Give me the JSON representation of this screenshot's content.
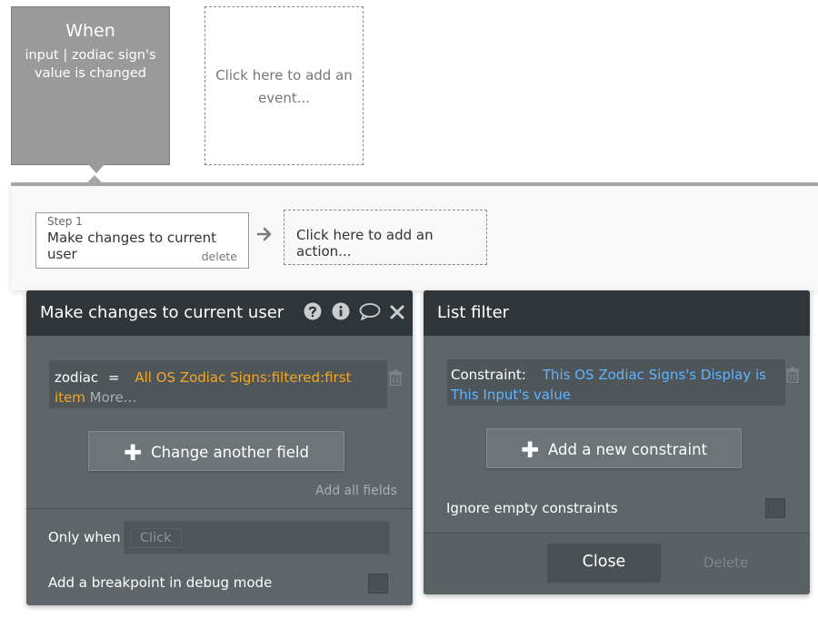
{
  "event": {
    "title": "When",
    "condition": "input | zodiac sign's value is changed",
    "add_event_label": "Click here to add an event..."
  },
  "steps": {
    "step1": {
      "label": "Step 1",
      "name": "Make changes to current user",
      "delete_label": "delete"
    },
    "add_action_label": "Click here to add an action..."
  },
  "left_panel": {
    "title": "Make changes to current user",
    "icons": [
      "help-icon",
      "info-icon",
      "comment-icon",
      "close-icon"
    ],
    "field": {
      "name": "zodiac",
      "operator": "=",
      "expression": "All OS Zodiac Signs:filtered:first item",
      "more": "More..."
    },
    "change_field_button": "Change another field",
    "add_all_fields": "Add all fields",
    "only_when_label": "Only when",
    "only_when_placeholder": "Click",
    "breakpoint_label": "Add a breakpoint in debug mode"
  },
  "right_panel": {
    "title": "List filter",
    "constraint": {
      "label": "Constraint:",
      "value": "This OS Zodiac Signs's Display is This Input's value"
    },
    "add_constraint_button": "Add a new constraint",
    "ignore_empty_label": "Ignore empty constraints",
    "close_button": "Close",
    "delete_button": "Delete"
  },
  "colors": {
    "panel_bg": "#5f666a",
    "panel_header": "#2f3538",
    "expression_orange": "#f5a623",
    "expression_blue": "#5fb3ff"
  }
}
